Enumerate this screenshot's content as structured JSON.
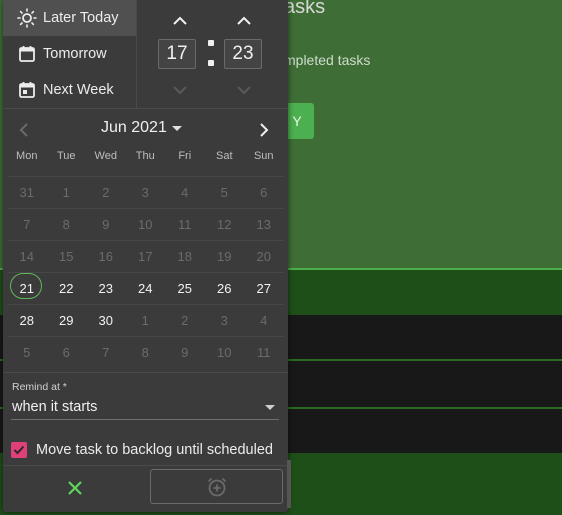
{
  "background": {
    "title_fragment": "asks",
    "subtitle_fragment": "mpleted tasks",
    "button_fragment": "Y"
  },
  "quick_options": [
    {
      "label": "Later Today",
      "icon": "sun-icon",
      "active": true
    },
    {
      "label": "Tomorrow",
      "icon": "calendar-icon",
      "active": false
    },
    {
      "label": "Next Week",
      "icon": "calendar-week-icon",
      "active": false
    }
  ],
  "time": {
    "hours": "17",
    "minutes": "23"
  },
  "calendar": {
    "month_label": "Jun 2021",
    "weekdays": [
      "Mon",
      "Tue",
      "Wed",
      "Thu",
      "Fri",
      "Sat",
      "Sun"
    ],
    "weeks": [
      [
        "31",
        "1",
        "2",
        "3",
        "4",
        "5",
        "6"
      ],
      [
        "7",
        "8",
        "9",
        "10",
        "11",
        "12",
        "13"
      ],
      [
        "14",
        "15",
        "16",
        "17",
        "18",
        "19",
        "20"
      ],
      [
        "21",
        "22",
        "23",
        "24",
        "25",
        "26",
        "27"
      ],
      [
        "28",
        "29",
        "30",
        "1",
        "2",
        "3",
        "4"
      ],
      [
        "5",
        "6",
        "7",
        "8",
        "9",
        "10",
        "11"
      ]
    ],
    "today": "21"
  },
  "remind": {
    "label": "Remind at *",
    "value": "when it starts"
  },
  "backlog": {
    "label": "Move task to backlog until scheduled",
    "checked": true
  },
  "colors": {
    "accent_check": "#e0407a",
    "cancel_icon": "#5ed65a",
    "today_ring": "#5fb85a",
    "bg_green": "#3e6e36"
  }
}
